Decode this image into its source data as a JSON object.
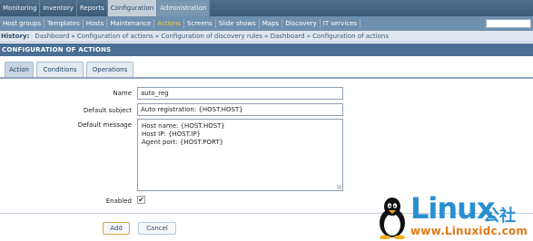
{
  "topnav": {
    "items": [
      "Monitoring",
      "Inventory",
      "Reports",
      "Configuration",
      "Administration"
    ],
    "active": "Configuration"
  },
  "subnav": {
    "items": [
      "Host groups",
      "Templates",
      "Hosts",
      "Maintenance",
      "Actions",
      "Screens",
      "Slide shows",
      "Maps",
      "Discovery",
      "IT services"
    ],
    "active": "Actions"
  },
  "history": {
    "label": "History:",
    "crumbs": [
      "Dashboard",
      "Configuration of actions",
      "Configuration of discovery rules",
      "Dashboard",
      "Configuration of actions"
    ],
    "sep": "»"
  },
  "section": {
    "title": "CONFIGURATION OF ACTIONS"
  },
  "tabs": [
    "Action",
    "Conditions",
    "Operations"
  ],
  "form": {
    "name_label": "Name",
    "name_value": "auto_reg",
    "subject_label": "Default subject",
    "subject_value": "Auto registration: {HOST.HOST}",
    "message_label": "Default message",
    "message_lines": [
      "Host name: {HOST.HOST}",
      "Host IP: {HOST.IP}",
      "Agent port: {HOST.PORT}"
    ],
    "enabled_label": "Enabled",
    "enabled_checked": true,
    "checkmark": "✔"
  },
  "buttons": {
    "add": "Add",
    "cancel": "Cancel"
  },
  "watermark": {
    "brand": "Linux",
    "cn": "公社",
    "url": "www.Linuxidc.com"
  },
  "colors": {
    "topbar": "#3f5f7e",
    "subbar": "#6f8fae",
    "section": "#4b6f94",
    "active_sub": "#f2d24b",
    "brand": "#2a8fd0",
    "url": "#e07a1a"
  }
}
